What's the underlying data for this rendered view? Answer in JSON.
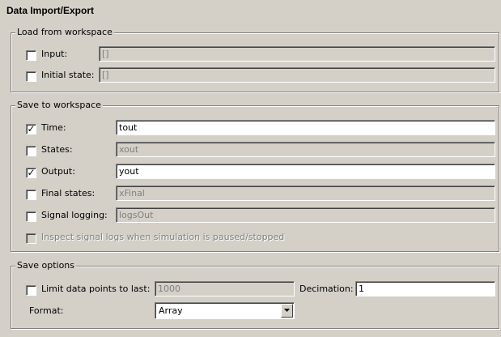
{
  "title": "Data Import/Export",
  "load_group": {
    "legend": "Load from workspace",
    "input": {
      "label": "Input:",
      "checked": false,
      "value": "[]"
    },
    "initial_state": {
      "label": "Initial state:",
      "checked": false,
      "value": "[]"
    }
  },
  "save_group": {
    "legend": "Save to workspace",
    "time": {
      "label": "Time:",
      "checked": true,
      "value": "tout"
    },
    "states": {
      "label": "States:",
      "checked": false,
      "value": "xout"
    },
    "output": {
      "label": "Output:",
      "checked": true,
      "value": "yout"
    },
    "final_states": {
      "label": "Final states:",
      "checked": false,
      "value": "xFinal"
    },
    "signal_logging": {
      "label": "Signal logging:",
      "checked": false,
      "value": "logsOut"
    },
    "inspect": {
      "label": "Inspect signal logs when simulation is paused/stopped",
      "checked": false
    }
  },
  "options_group": {
    "legend": "Save options",
    "limit": {
      "label": "Limit data points to last:",
      "checked": false,
      "value": "1000"
    },
    "decimation": {
      "label": "Decimation:",
      "value": "1"
    },
    "format": {
      "label": "Format:",
      "value": "Array"
    }
  },
  "check_glyph": "✓",
  "icons": {
    "dropdown": "chevron-down-icon"
  }
}
